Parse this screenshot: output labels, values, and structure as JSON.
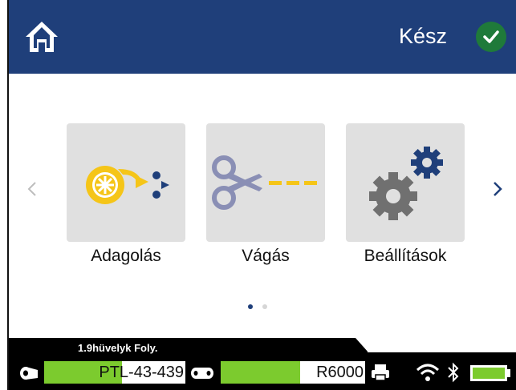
{
  "header": {
    "title": "Kész",
    "home_icon": "home-icon",
    "status_icon": "check-icon",
    "bg_color": "#1f3f7a",
    "status_color": "#1f7a3a"
  },
  "tiles": [
    {
      "label": "Adagolás",
      "icon": "feed-icon"
    },
    {
      "label": "Vágás",
      "icon": "scissors-icon"
    },
    {
      "label": "Beállítások",
      "icon": "gears-icon"
    }
  ],
  "pagination": {
    "current": 1,
    "total": 2
  },
  "statusbar": {
    "media_label": "1.9hüvelyk Foly.",
    "media_part_number": "PTL-43-439",
    "media_remaining_fraction": 0.55,
    "ribbon_part_number": "R6000",
    "ribbon_remaining_fraction": 0.55,
    "battery_fraction": 1.0,
    "accent_color": "#7ccb2e"
  }
}
